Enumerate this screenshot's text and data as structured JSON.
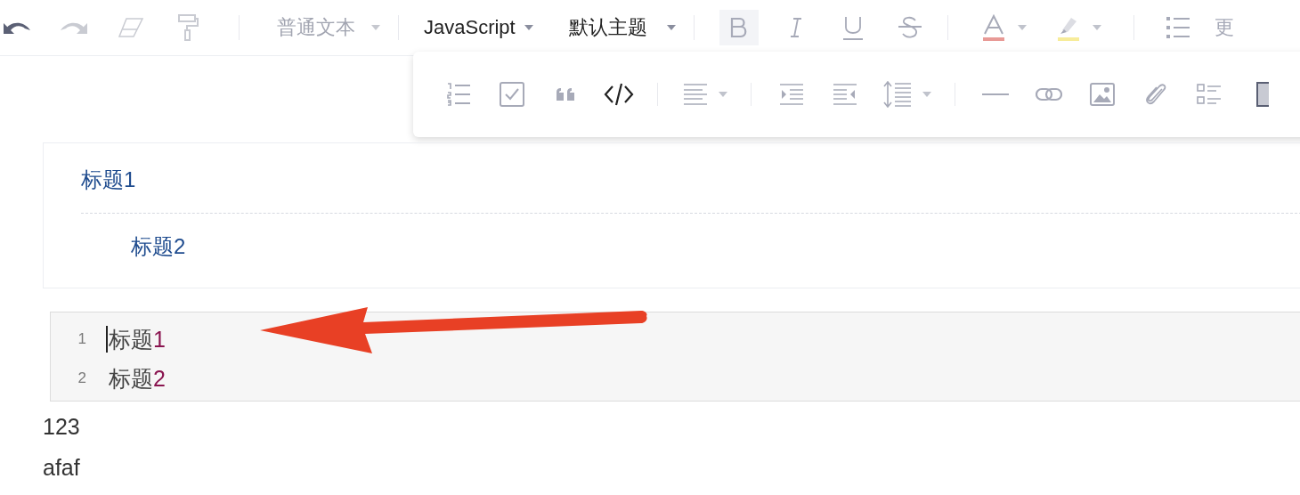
{
  "toolbar": {
    "undo": {
      "disabled": false
    },
    "redo": {
      "disabled": true
    },
    "clear_format": {
      "disabled": true
    },
    "format_painter": {
      "disabled": true
    },
    "block_type": {
      "value": "普通文本",
      "disabled": true
    },
    "language": {
      "value": "JavaScript",
      "disabled": false
    },
    "theme": {
      "value": "默认主题",
      "disabled": false
    },
    "bold": {
      "active": true
    },
    "italic": {
      "active": false
    },
    "underline": {
      "active": false
    },
    "strikethrough": {
      "active": false
    },
    "more": "更"
  },
  "floating_toolbar": {
    "code_block": {
      "active": true
    }
  },
  "table_of_contents": [
    {
      "text": "标题1",
      "children": [
        {
          "text": "标题2"
        }
      ]
    }
  ],
  "code_block": {
    "lines": [
      {
        "number": "1",
        "cursor": true,
        "segments": [
          {
            "kind": "plain",
            "text": "标题"
          },
          {
            "kind": "number",
            "text": "1"
          }
        ]
      },
      {
        "number": "2",
        "cursor": false,
        "segments": [
          {
            "kind": "plain",
            "text": "标题"
          },
          {
            "kind": "number",
            "text": "2"
          }
        ]
      }
    ]
  },
  "paragraphs": [
    "123",
    "afaf"
  ]
}
